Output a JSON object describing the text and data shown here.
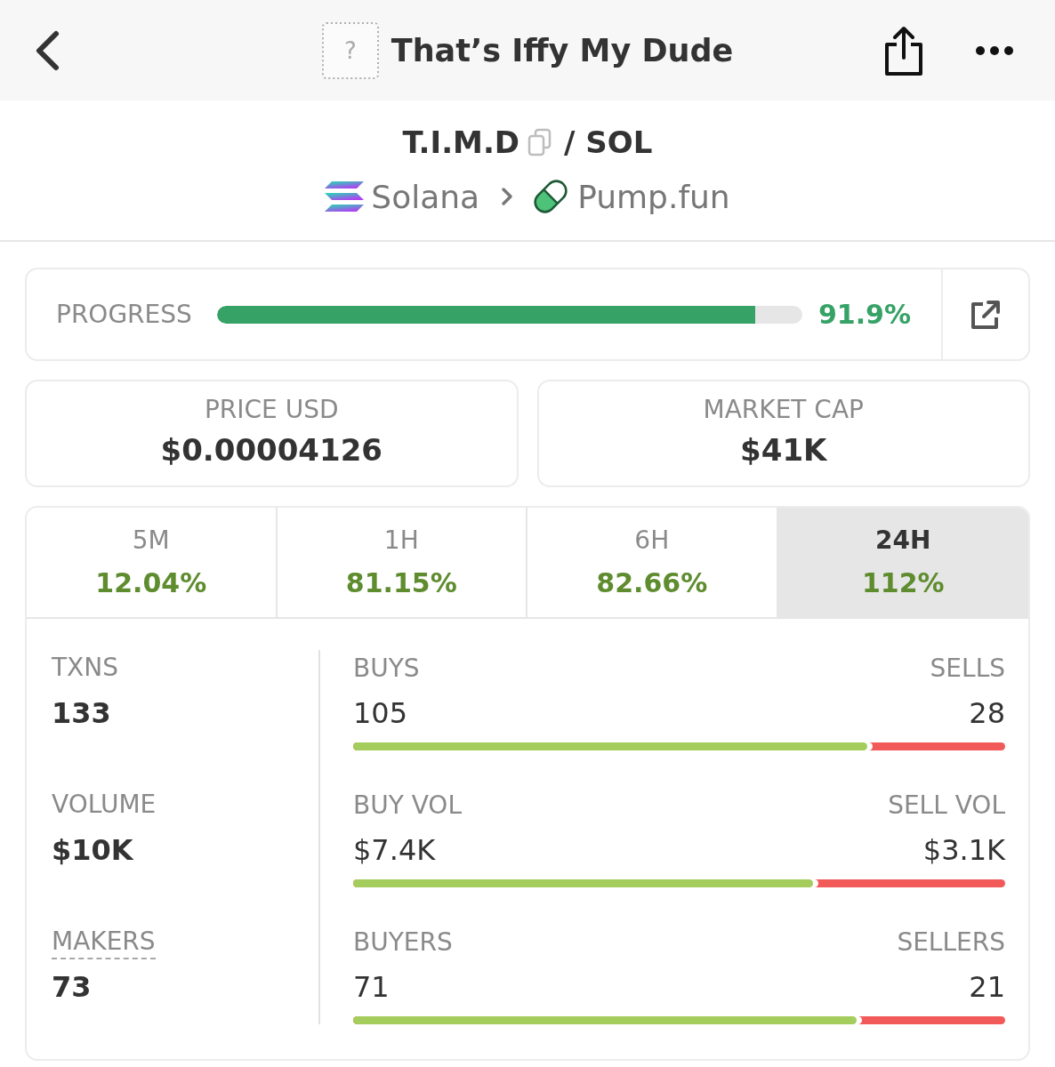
{
  "header": {
    "image_placeholder": "?",
    "title": "That’s Iffy My Dude"
  },
  "pair": {
    "base": "T.I.M.D",
    "quote": "/ SOL",
    "chain": "Solana",
    "dex": "Pump.fun"
  },
  "progress": {
    "label": "PROGRESS",
    "level": 0.919,
    "value": "91.9%"
  },
  "stats": [
    {
      "label": "PRICE USD",
      "value": "$0.00004126"
    },
    {
      "label": "MARKET CAP",
      "value": "$41K"
    }
  ],
  "periods": [
    {
      "label": "5M",
      "change": "12.04%",
      "selected": false
    },
    {
      "label": "1H",
      "change": "81.15%",
      "selected": false
    },
    {
      "label": "6H",
      "change": "82.66%",
      "selected": false
    },
    {
      "label": "24H",
      "change": "112%",
      "selected": true
    }
  ],
  "totals": [
    {
      "label": "TXNS",
      "value": "133",
      "tooltip": false
    },
    {
      "label": "VOLUME",
      "value": "$10K",
      "tooltip": false
    },
    {
      "label": "MAKERS",
      "value": "73",
      "tooltip": true
    }
  ],
  "splits": [
    {
      "buy_label": "BUYS",
      "buy_value": "105",
      "sell_label": "SELLS",
      "sell_value": "28",
      "level": 0.789
    },
    {
      "buy_label": "BUY VOL",
      "buy_value": "$7.4K",
      "sell_label": "SELL VOL",
      "sell_value": "$3.1K",
      "level": 0.705
    },
    {
      "buy_label": "BUYERS",
      "buy_value": "71",
      "sell_label": "SELLERS",
      "sell_value": "21",
      "level": 0.772
    }
  ]
}
